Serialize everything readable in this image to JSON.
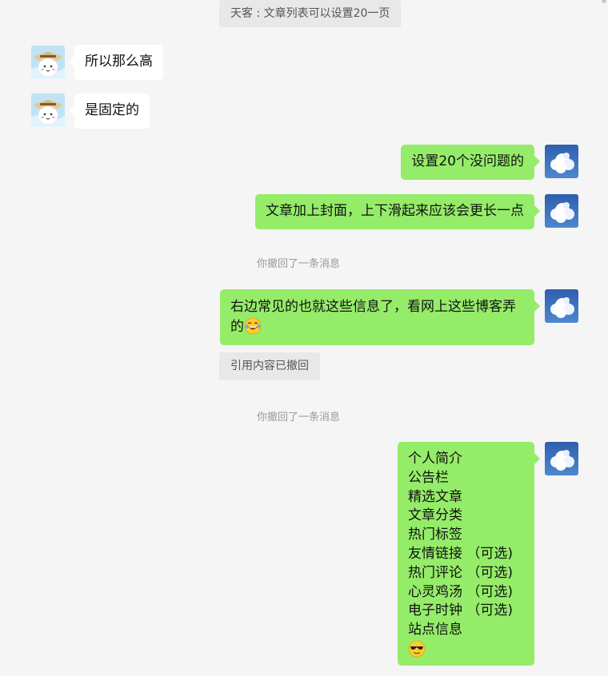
{
  "messages": {
    "top_quote": "天客 : 文章列表可以设置20一页",
    "in_1": "所以那么高",
    "in_2": "是固定的",
    "out_1": "设置20个没问题的",
    "out_2": "文章加上封面，上下滑起来应该会更长一点",
    "recall_1": "你撤回了一条消息",
    "out_3_line1": "右边常见的也就这些信息了，看网上这些博客弄",
    "out_3_line2": "的",
    "quote_recalled": "引用内容已撤回",
    "recall_2": "你撤回了一条消息",
    "out_4_lines": [
      "个人简介",
      "公告栏",
      "精选文章",
      "文章分类",
      "热门标签",
      "友情链接 （可选)",
      "热门评论 （可选)",
      "心灵鸡汤 （可选)",
      "电子时钟 （可选)",
      "站点信息"
    ]
  },
  "icons": {
    "incoming_avatar": "girl-with-straw-hat-avatar",
    "outgoing_avatar": "blue-sky-cloud-avatar",
    "laugh_emoji": "tears-of-joy-emoji-icon",
    "cool_emoji": "sunglasses-emoji-icon"
  },
  "colors": {
    "background": "#f5f5f5",
    "outgoing_bubble": "#95ec69",
    "incoming_bubble": "#ffffff",
    "notice_text": "#999999"
  }
}
